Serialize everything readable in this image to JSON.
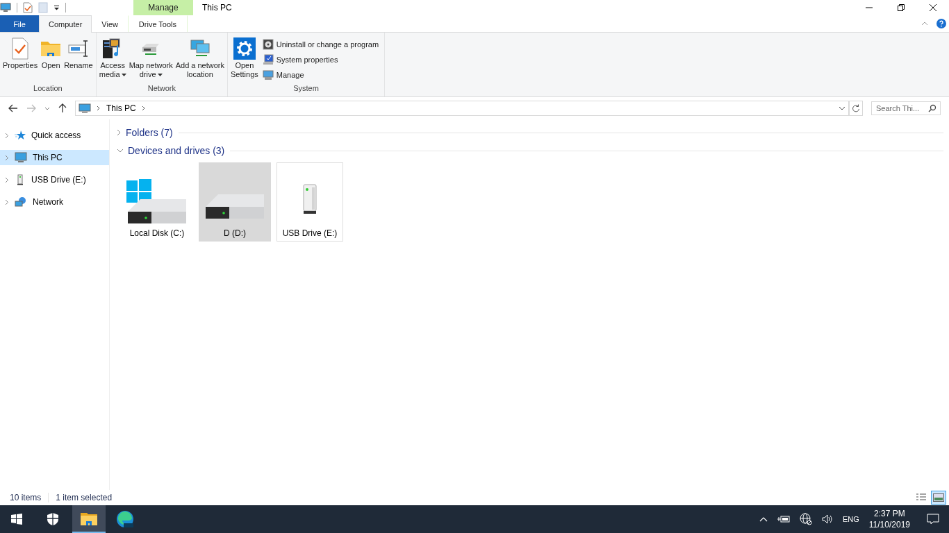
{
  "window": {
    "title": "This PC",
    "contextual_label": "Manage"
  },
  "tabs": [
    {
      "label": "File",
      "kind": "file",
      "selected": false
    },
    {
      "label": "Computer",
      "kind": "normal",
      "selected": true
    },
    {
      "label": "View",
      "kind": "normal",
      "selected": false
    },
    {
      "label": "Drive Tools",
      "kind": "contextual",
      "selected": false
    }
  ],
  "ribbon_groups": [
    {
      "label": "Location",
      "buttons": [
        {
          "lines": [
            "Properties"
          ],
          "kind": "properties",
          "dropdown": false
        },
        {
          "lines": [
            "Open"
          ],
          "kind": "folder",
          "dropdown": false
        },
        {
          "lines": [
            "Rename"
          ],
          "kind": "rename",
          "dropdown": false
        }
      ]
    },
    {
      "label": "Network",
      "buttons": [
        {
          "lines": [
            "Access",
            "media"
          ],
          "kind": "media",
          "dropdown": true
        },
        {
          "lines": [
            "Map network",
            "drive"
          ],
          "kind": "netdrive",
          "dropdown": true
        },
        {
          "lines": [
            "Add a network",
            "location"
          ],
          "kind": "netloc",
          "dropdown": false
        }
      ]
    },
    {
      "label": "System",
      "buttons": [
        {
          "lines": [
            "Open",
            "Settings"
          ],
          "kind": "settings",
          "dropdown": false
        }
      ],
      "small": [
        {
          "label": "Uninstall or change a program",
          "kind": "disc"
        },
        {
          "label": "System properties",
          "kind": "sysprop"
        },
        {
          "label": "Manage",
          "kind": "manage"
        }
      ]
    }
  ],
  "address": {
    "path": [
      "This PC"
    ],
    "search_placeholder": "Search Thi..."
  },
  "nav_items": [
    {
      "label": "Quick access",
      "kind": "star",
      "selected": false
    },
    {
      "label": "This PC",
      "kind": "pc",
      "selected": true
    },
    {
      "label": "USB Drive (E:)",
      "kind": "usb",
      "selected": false
    },
    {
      "label": "Network",
      "kind": "network",
      "selected": false
    }
  ],
  "groups": [
    {
      "title": "Folders (7)",
      "expanded": false
    },
    {
      "title": "Devices and drives (3)",
      "expanded": true,
      "items": [
        {
          "label": "Local Disk (C:)",
          "kind": "system-disk",
          "selected": false,
          "focused": false
        },
        {
          "label": "D (D:)",
          "kind": "disk",
          "selected": true,
          "focused": false
        },
        {
          "label": "USB Drive (E:)",
          "kind": "usb",
          "selected": false,
          "focused": true
        }
      ]
    }
  ],
  "status_bar": {
    "count": "10 items",
    "selection": "1 item selected",
    "views": [
      {
        "kind": "details",
        "selected": false
      },
      {
        "kind": "large",
        "selected": true
      }
    ]
  },
  "taskbar": {
    "apps": [
      {
        "kind": "start",
        "active": false
      },
      {
        "kind": "shield",
        "active": false
      },
      {
        "kind": "explorer",
        "active": true
      },
      {
        "kind": "edge",
        "active": false
      }
    ],
    "language": "ENG",
    "time": "2:37 PM",
    "date": "11/10/2019"
  }
}
